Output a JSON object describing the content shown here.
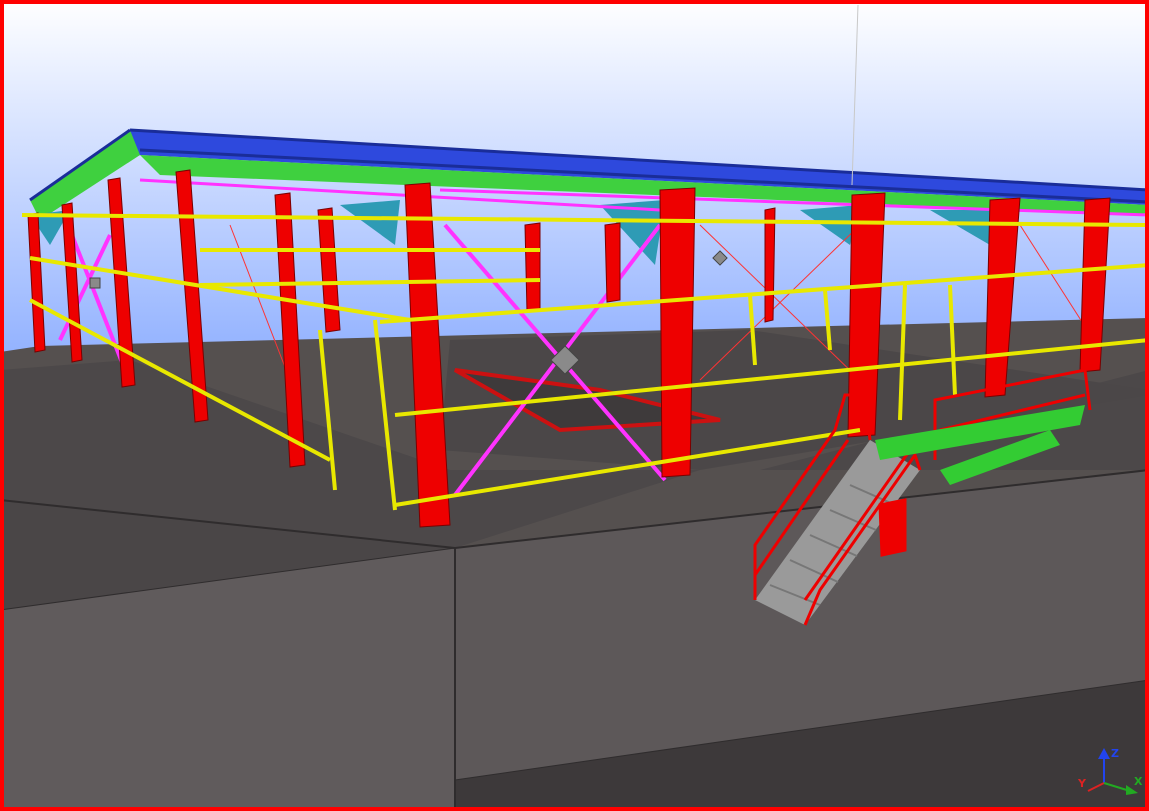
{
  "view": {
    "background_top": "#ffffff",
    "background_bottom": "#7fa4ff",
    "frame_color": "#ff0000"
  },
  "model": {
    "column_color": "#ee0000",
    "roof_purlin_color": "#1f3ed8",
    "rafter_color": "#33cc33",
    "knee_brace_color": "#2e9bb5",
    "bracing_color": "#ff00ff",
    "girt_color": "#e8e800",
    "ground_color": "#5f5a5c",
    "stair_color": "#ee0000",
    "platform_color": "#33cc33"
  },
  "axes": {
    "x_label": "X",
    "y_label": "Y",
    "z_label": "Z",
    "x_color": "#22aa22",
    "y_color": "#dd2222",
    "z_color": "#2244ee"
  }
}
